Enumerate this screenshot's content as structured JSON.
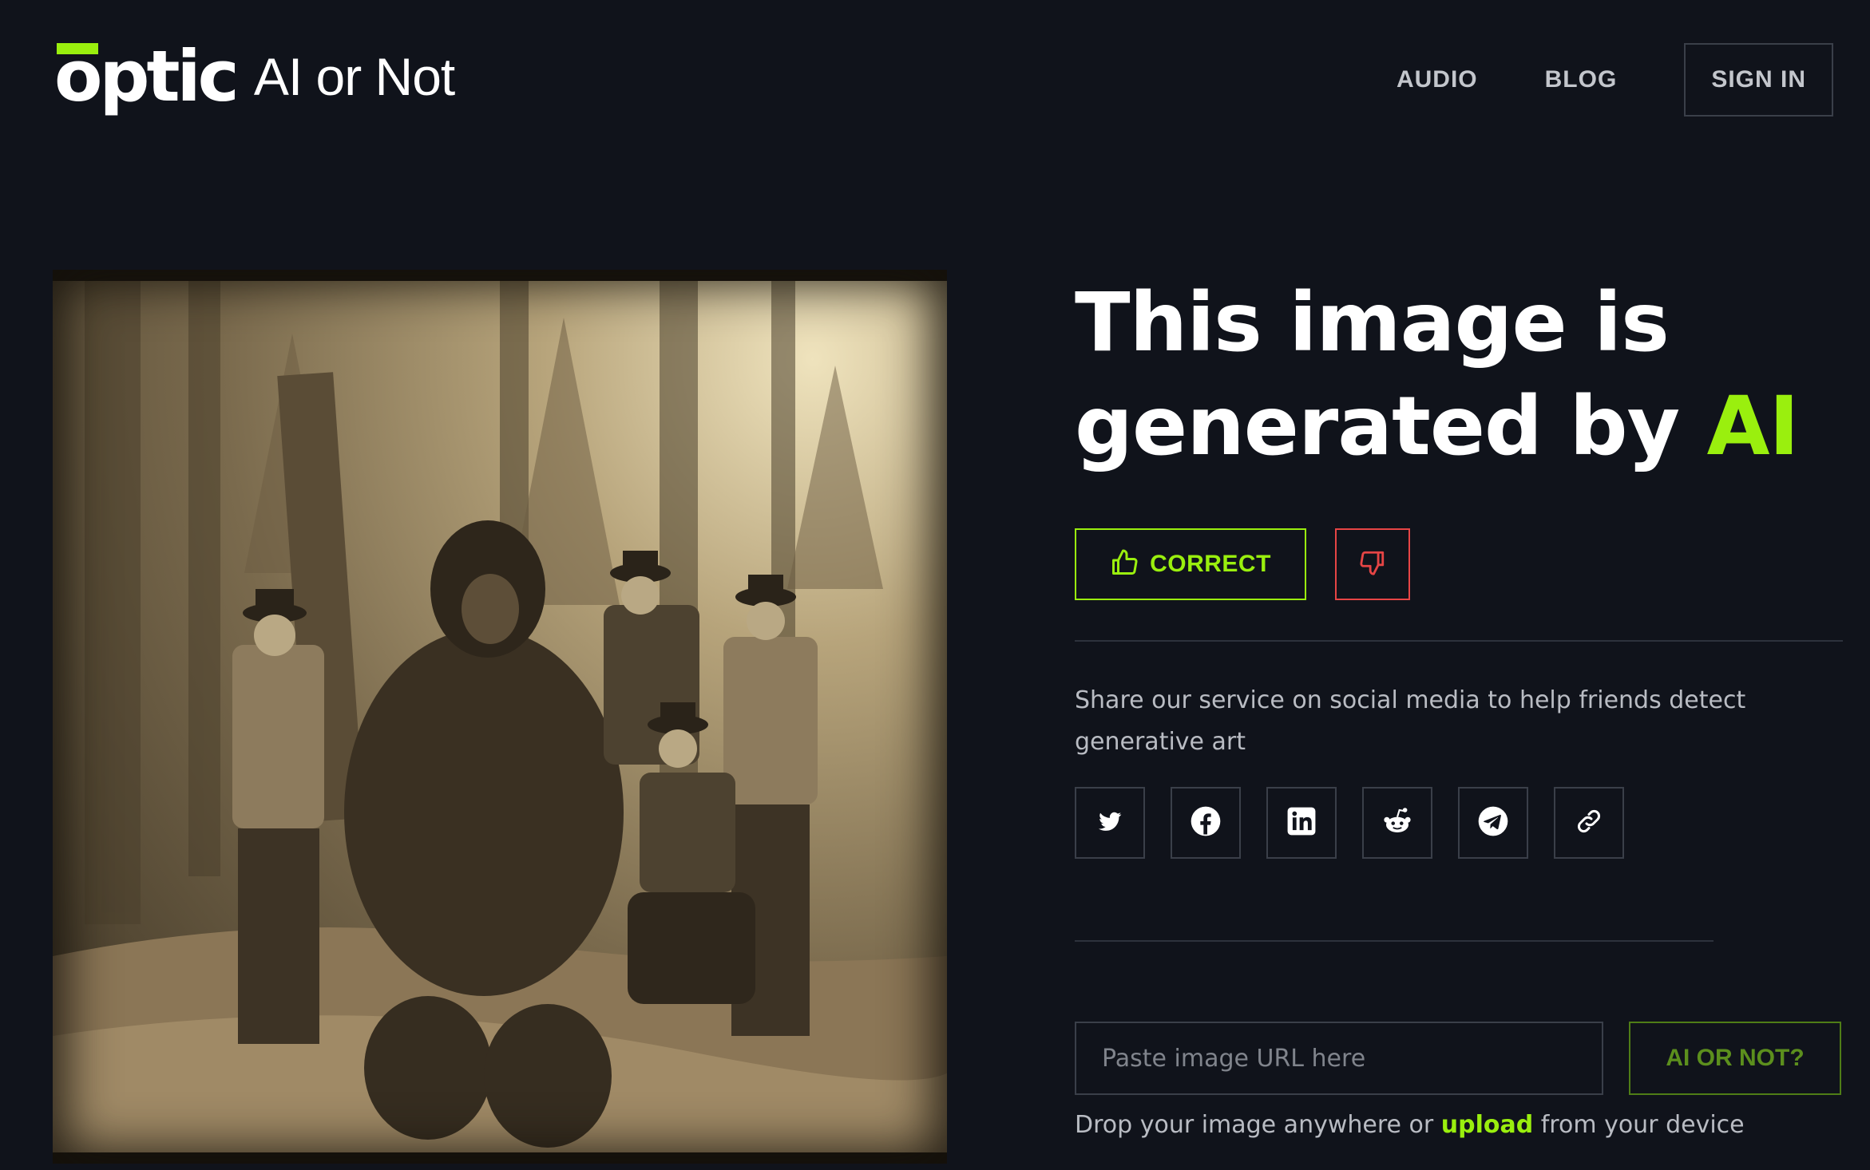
{
  "header": {
    "logo_mark": "optic",
    "logo_text": "AI or Not",
    "nav": [
      "AUDIO",
      "BLOG"
    ],
    "sign_in": "SIGN IN"
  },
  "result": {
    "headline_line1": "This image is",
    "headline_line2_prefix": "generated by ",
    "headline_accent": "AI",
    "correct_label": "CORRECT"
  },
  "share": {
    "text": "Share our service on social media to help friends detect generative art",
    "icons": [
      "twitter-icon",
      "facebook-icon",
      "linkedin-icon",
      "reddit-icon",
      "telegram-icon",
      "link-icon"
    ]
  },
  "search": {
    "placeholder": "Paste image URL here",
    "submit_label": "AI OR NOT?",
    "drop_prefix": "Drop your image anywhere or ",
    "upload_link": "upload",
    "drop_suffix": " from your device"
  },
  "colors": {
    "background": "#10131b",
    "accent": "#9aef0e",
    "danger": "#e64545"
  }
}
